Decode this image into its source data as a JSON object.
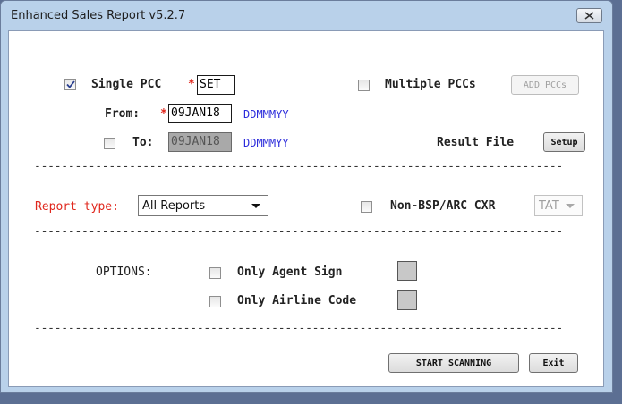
{
  "window": {
    "title": "Enhanced Sales Report v5.2.7"
  },
  "pcc": {
    "single_label": "Single PCC",
    "single_checked": true,
    "required_mark": "*",
    "single_value": "SET",
    "multiple_label": "Multiple PCCs",
    "multiple_checked": false,
    "add_button": "ADD PCCs"
  },
  "dates": {
    "from_label": "From:",
    "from_value": "09JAN18",
    "format_hint": "DDMMMYY",
    "to_label": "To:",
    "to_checked": false,
    "to_value": "09JAN18"
  },
  "result_file": {
    "label": "Result File",
    "setup_button": "Setup"
  },
  "separator": "------------------------------------------------------------------------------",
  "report": {
    "type_label": "Report type:",
    "type_value": "All Reports",
    "non_bsp_label": "Non-BSP/ARC CXR",
    "non_bsp_checked": false,
    "carrier_value": "TAT"
  },
  "options": {
    "label": "OPTIONS:",
    "agent_sign_label": "Only Agent Sign",
    "airline_code_label": "Only Airline Code"
  },
  "actions": {
    "start": "START SCANNING",
    "exit": "Exit"
  },
  "colors": {
    "accent_red": "#e0281e",
    "hint_blue": "#2b2bdb",
    "frame": "#b9d1ea"
  }
}
